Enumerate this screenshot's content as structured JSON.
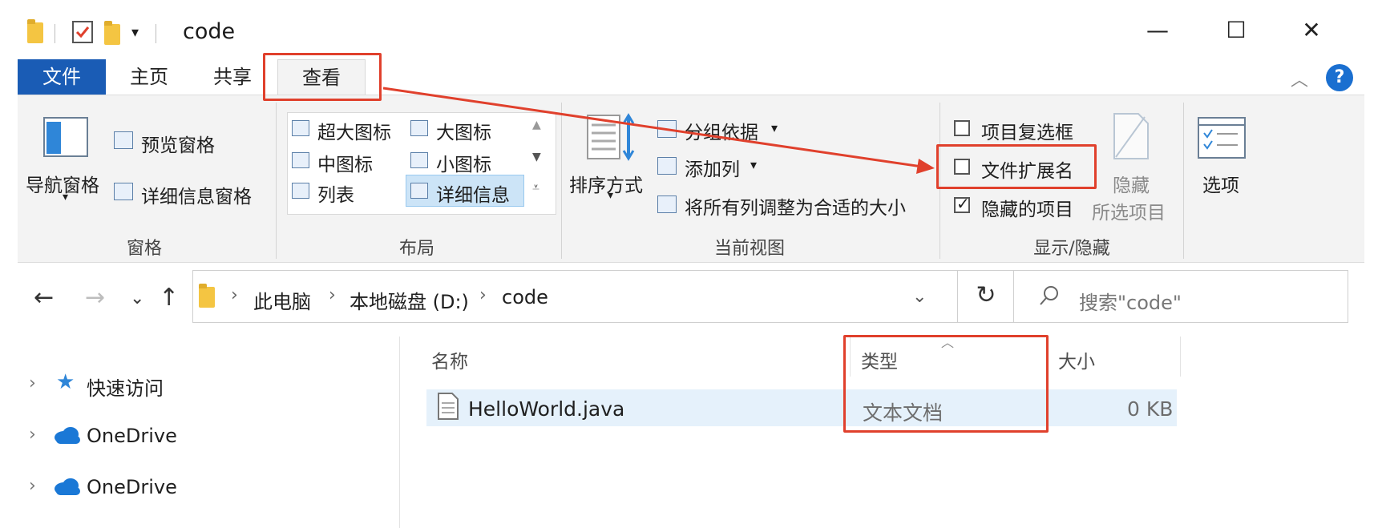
{
  "window": {
    "title": "code",
    "minimize": "—",
    "maximize": "☐",
    "close": "✕"
  },
  "tabs": [
    "文件",
    "主页",
    "共享",
    "查看"
  ],
  "ribbon": {
    "panes": {
      "label": "窗格",
      "nav_pane": "导航窗格",
      "preview_pane": "预览窗格",
      "details_pane": "详细信息窗格"
    },
    "layout": {
      "label": "布局",
      "items": [
        "超大图标",
        "大图标",
        "中图标",
        "小图标",
        "列表",
        "详细信息"
      ]
    },
    "current_view": {
      "label": "当前视图",
      "sort_by": "排序方式",
      "group_by": "分组依据",
      "add_columns": "添加列",
      "size_all_columns": "将所有列调整为合适的大小"
    },
    "show_hide": {
      "label": "显示/隐藏",
      "item_checkboxes": "项目复选框",
      "file_extensions": "文件扩展名",
      "hidden_items": "隐藏的项目",
      "hide_selected_line1": "隐藏",
      "hide_selected_line2": "所选项目"
    },
    "options": "选项"
  },
  "address": {
    "segments": [
      "此电脑",
      "本地磁盘 (D:)",
      "code"
    ],
    "search_placeholder": "搜索\"code\""
  },
  "nav_pane": {
    "items": [
      "快速访问",
      "OneDrive",
      "OneDrive"
    ]
  },
  "columns": [
    "名称",
    "类型",
    "大小"
  ],
  "files": [
    {
      "name": "HelloWorld.java",
      "type": "文本文档",
      "size": "0 KB"
    }
  ],
  "colors": {
    "accent": "#1a5cb5",
    "annotation": "#e0402c",
    "selection": "#cce4f7"
  }
}
